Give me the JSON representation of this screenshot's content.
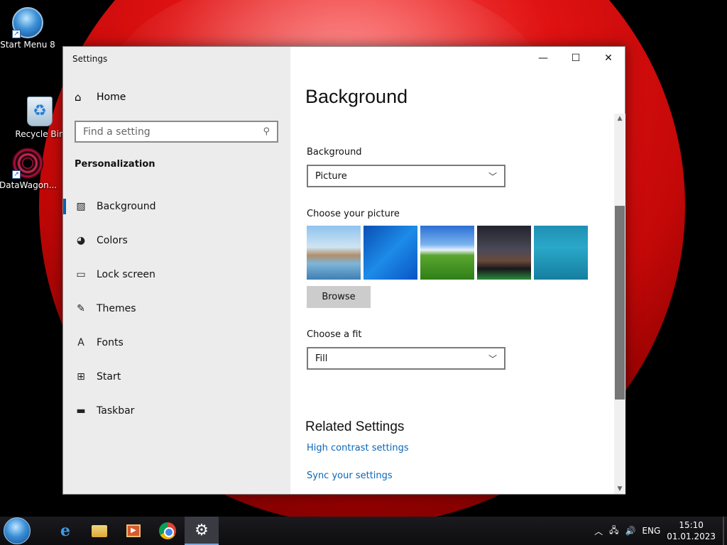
{
  "desktop": {
    "icons": [
      {
        "label": "Start Menu 8"
      },
      {
        "label": "Recycle Bin"
      },
      {
        "label": "DataWagon..."
      }
    ]
  },
  "window": {
    "title": "Settings",
    "controls": {
      "minimize": "—",
      "maximize": "☐",
      "close": "✕"
    }
  },
  "sidebar": {
    "home": "Home",
    "search_placeholder": "Find a setting",
    "section": "Personalization",
    "items": [
      {
        "label": "Background",
        "icon": "picture-icon",
        "active": true
      },
      {
        "label": "Colors",
        "icon": "palette-icon"
      },
      {
        "label": "Lock screen",
        "icon": "lock-screen-icon"
      },
      {
        "label": "Themes",
        "icon": "brush-icon"
      },
      {
        "label": "Fonts",
        "icon": "font-icon"
      },
      {
        "label": "Start",
        "icon": "start-grid-icon"
      },
      {
        "label": "Taskbar",
        "icon": "taskbar-icon"
      }
    ]
  },
  "main": {
    "title": "Background",
    "background_label": "Background",
    "background_value": "Picture",
    "choose_picture_label": "Choose your picture",
    "browse_label": "Browse",
    "fit_label": "Choose a fit",
    "fit_value": "Fill",
    "related_title": "Related Settings",
    "links": [
      "High contrast settings",
      "Sync your settings"
    ]
  },
  "taskbar": {
    "apps": [
      "Internet Explorer",
      "File Explorer",
      "Media Player",
      "Chrome",
      "Settings"
    ],
    "language": "ENG",
    "time": "15:10",
    "date": "01.01.2023"
  }
}
